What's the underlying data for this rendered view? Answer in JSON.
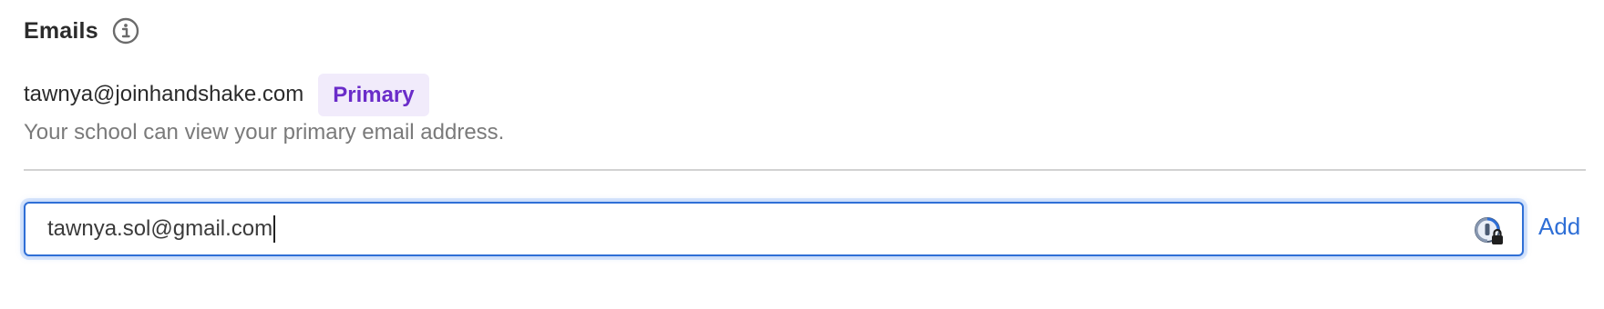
{
  "section": {
    "title": "Emails",
    "info_icon": "info-circle-icon"
  },
  "primary": {
    "email": "tawnya@joinhandshake.com",
    "badge": "Primary",
    "badge_bg": "#f1ebfb",
    "badge_color": "#6a2cc9",
    "helper_text": "Your school can view your primary email address."
  },
  "new_email": {
    "value": "tawnya.sol@gmail.com",
    "password_manager_icon": "password-manager-lock-icon",
    "add_label": "Add",
    "focus_color": "#2f6fd6"
  }
}
